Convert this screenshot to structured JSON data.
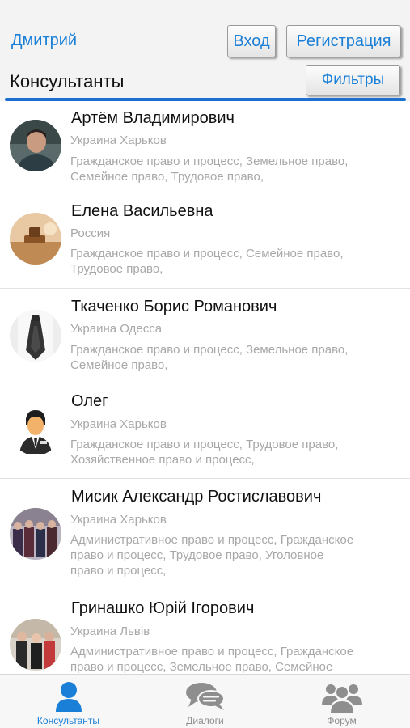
{
  "header": {
    "user_name": "Дмитрий",
    "login_label": "Вход",
    "register_label": "Регистрация",
    "title": "Консультанты",
    "filters_label": "Фильтры",
    "accent_color": "#1d6fd0"
  },
  "consultants": [
    {
      "name": "Артём Владимирович",
      "location": "Украина Харьков",
      "spec_lines": [
        "Гражданское право и процесс, Земельное право,",
        "Семейное право, Трудовое право,"
      ]
    },
    {
      "name": "Елена  Васильевна",
      "location": "Россия",
      "spec_lines": [
        "Гражданское право и процесс, Семейное право,",
        "Трудовое право,"
      ]
    },
    {
      "name": "Ткаченко  Борис  Романович",
      "location": "Украина Одесса",
      "spec_lines": [
        "Гражданское право и процесс, Земельное право,",
        "Семейное право,"
      ]
    },
    {
      "name": "Олег",
      "location": "Украина Харьков",
      "spec_lines": [
        "Гражданское право и процесс, Трудовое право,",
        "Хозяйственное право и процесс,"
      ]
    },
    {
      "name": "Мисик  Александр Ростиславович",
      "location": "Украина Харьков",
      "spec_lines": [
        "Административное право и процесс, Гражданское",
        "право и процесс, Трудовое право, Уголовное",
        "право и процесс,"
      ]
    },
    {
      "name": "Гринашко Юрій Ігорович",
      "location": "Украина Львів",
      "spec_lines": [
        "Административное право и процесс, Гражданское",
        "право и процесс, Земельное право, Семейное"
      ]
    }
  ],
  "tabs": [
    {
      "label": "Консультанты",
      "icon": "person-icon",
      "active": true
    },
    {
      "label": "Диалоги",
      "icon": "chat-bubbles-icon",
      "active": false
    },
    {
      "label": "Форум",
      "icon": "group-icon",
      "active": false
    }
  ]
}
